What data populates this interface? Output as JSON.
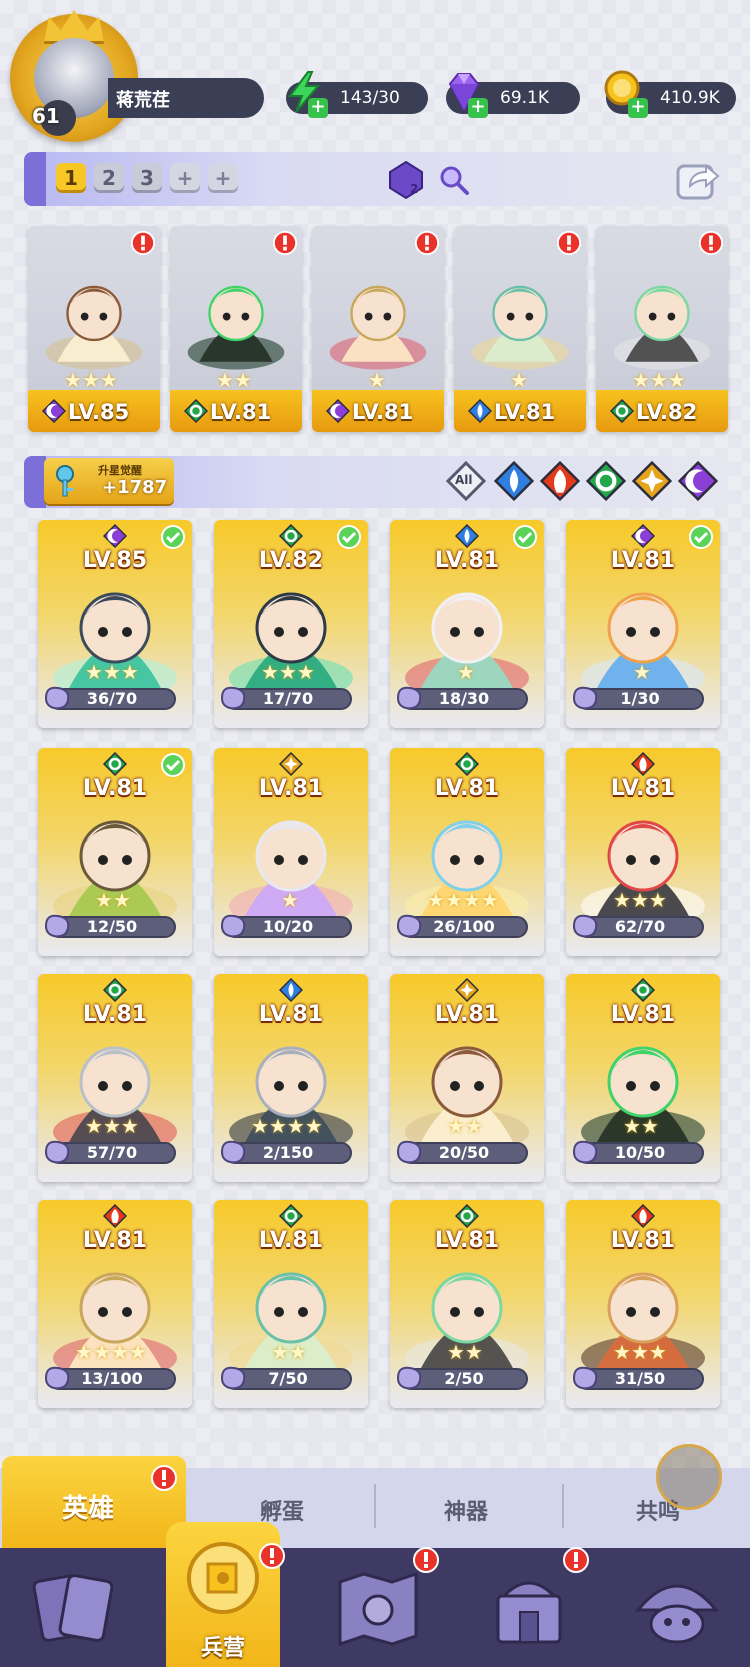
{
  "player": {
    "level": "61",
    "name": "蒋荒荏"
  },
  "resources": {
    "energy": "143/30",
    "gems": "69.1K",
    "gold": "410.9K"
  },
  "team_tabs": [
    "1",
    "2",
    "3",
    "+",
    "+"
  ],
  "team_item_badge": "2",
  "team": [
    {
      "level": "LV.85",
      "element": "dark",
      "stars": 3
    },
    {
      "level": "LV.81",
      "element": "nature",
      "stars": 2
    },
    {
      "level": "LV.81",
      "element": "dark",
      "stars": 1
    },
    {
      "level": "LV.81",
      "element": "water",
      "stars": 1
    },
    {
      "level": "LV.82",
      "element": "nature",
      "stars": 3
    }
  ],
  "awaken": {
    "title": "升星觉醒",
    "value": "+1787"
  },
  "filter": {
    "all_label": "All",
    "elements": [
      "water",
      "fire",
      "nature",
      "light",
      "dark"
    ]
  },
  "heroes": [
    {
      "level": "LV.85",
      "element": "dark",
      "stars": 3,
      "shards": "36/70",
      "check": true
    },
    {
      "level": "LV.82",
      "element": "nature",
      "stars": 3,
      "shards": "17/70",
      "check": true
    },
    {
      "level": "LV.81",
      "element": "water",
      "stars": 1,
      "shards": "18/30",
      "check": true
    },
    {
      "level": "LV.81",
      "element": "dark",
      "stars": 1,
      "shards": "1/30",
      "check": true
    },
    {
      "level": "LV.81",
      "element": "nature",
      "stars": 2,
      "shards": "12/50",
      "check": true
    },
    {
      "level": "LV.81",
      "element": "light",
      "stars": 1,
      "shards": "10/20",
      "check": false
    },
    {
      "level": "LV.81",
      "element": "nature",
      "stars": 4,
      "shards": "26/100",
      "check": false
    },
    {
      "level": "LV.81",
      "element": "fire",
      "stars": 3,
      "shards": "62/70",
      "check": false
    },
    {
      "level": "LV.81",
      "element": "nature",
      "stars": 3,
      "shards": "57/70",
      "check": false
    },
    {
      "level": "LV.81",
      "element": "water",
      "stars": 4,
      "shards": "2/150",
      "check": false
    },
    {
      "level": "LV.81",
      "element": "light",
      "stars": 2,
      "shards": "20/50",
      "check": false
    },
    {
      "level": "LV.81",
      "element": "nature",
      "stars": 2,
      "shards": "10/50",
      "check": false
    },
    {
      "level": "LV.81",
      "element": "fire",
      "stars": 4,
      "shards": "13/100",
      "check": false
    },
    {
      "level": "LV.81",
      "element": "nature",
      "stars": 2,
      "shards": "7/50",
      "check": false
    },
    {
      "level": "LV.81",
      "element": "nature",
      "stars": 2,
      "shards": "2/50",
      "check": false
    },
    {
      "level": "LV.81",
      "element": "fire",
      "stars": 3,
      "shards": "31/50",
      "check": false
    }
  ],
  "tabs": {
    "heroes": "英雄",
    "hatch": "孵蛋",
    "artifact": "神器",
    "resonance": "共鸣"
  },
  "nav": {
    "barracks": "兵营"
  },
  "colors": {
    "gold": "#f7c21e",
    "purple_bar": "#3b3f55",
    "nav_bg": "#3f3a63",
    "element_water": "#2f7fe0",
    "element_fire": "#e33a1c",
    "element_nature": "#22a84a",
    "element_light": "#e6a41a",
    "element_dark": "#8b3fd6"
  }
}
